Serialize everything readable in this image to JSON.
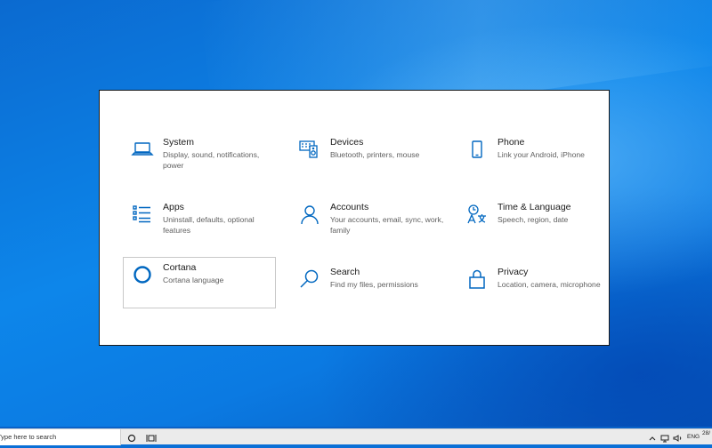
{
  "settings": {
    "tiles": [
      {
        "title": "System",
        "desc": "Display, sound, notifications, power",
        "icon": "laptop-icon"
      },
      {
        "title": "Devices",
        "desc": "Bluetooth, printers, mouse",
        "icon": "devices-icon"
      },
      {
        "title": "Phone",
        "desc": "Link your Android, iPhone",
        "icon": "phone-icon"
      },
      {
        "title": "Apps",
        "desc": "Uninstall, defaults, optional features",
        "icon": "apps-list-icon"
      },
      {
        "title": "Accounts",
        "desc": "Your accounts, email, sync, work, family",
        "icon": "person-icon"
      },
      {
        "title": "Time & Language",
        "desc": "Speech, region, date",
        "icon": "time-language-icon"
      },
      {
        "title": "Cortana",
        "desc": "Cortana language",
        "icon": "cortana-circle-icon"
      },
      {
        "title": "Search",
        "desc": "Find my files, permissions",
        "icon": "search-icon"
      },
      {
        "title": "Privacy",
        "desc": "Location, camera, microphone",
        "icon": "lock-icon"
      }
    ],
    "accent": "#0067c0"
  },
  "taskbar": {
    "search_text": "Type here to search",
    "lang": "ENG",
    "date_partial": "28/"
  }
}
